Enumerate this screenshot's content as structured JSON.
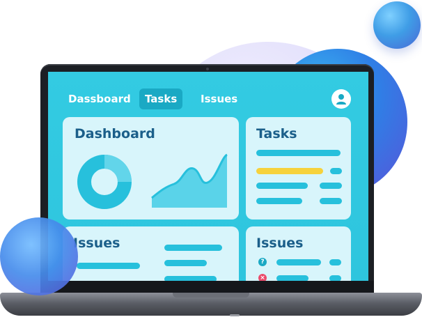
{
  "nav": {
    "items": [
      {
        "label": "Dassboard",
        "active": false
      },
      {
        "label": "Tasks",
        "active": true
      },
      {
        "label": "Issues",
        "active": false
      }
    ],
    "user_icon": "user-icon"
  },
  "cards": {
    "dashboard": {
      "title": "Dashboard",
      "charts": [
        "donut-chart",
        "area-chart"
      ]
    },
    "tasks_top": {
      "title": "Tasks",
      "highlight_color": "#f6d23c"
    },
    "issues": {
      "title": "Issues"
    },
    "tasks_bottom": {
      "title": "Issues",
      "status_icons": [
        "info-icon",
        "close-icon"
      ]
    }
  },
  "colors": {
    "screen": "#30c9e0",
    "card": "#d8f5fb",
    "title": "#1b5f8a",
    "bar": "#27c0dc",
    "highlight": "#f6d23c",
    "nav_active": "#1aa9c4"
  }
}
